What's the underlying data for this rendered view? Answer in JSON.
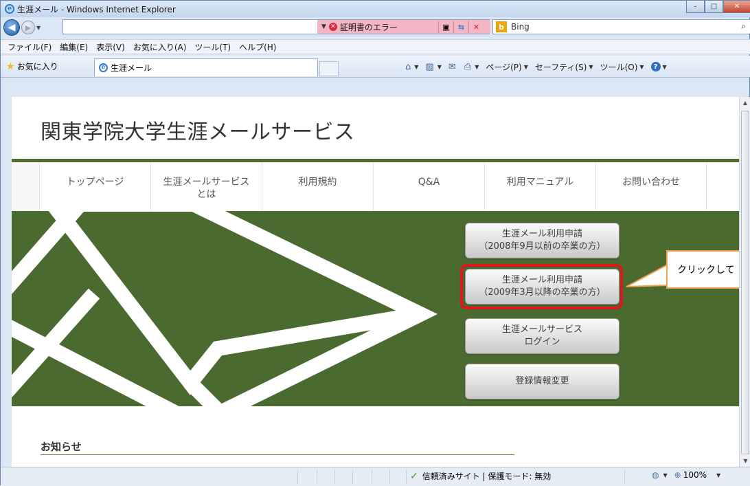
{
  "window": {
    "title": "生涯メール - Windows Internet Explorer",
    "minimize": "–",
    "maximize": "□",
    "close": "✕"
  },
  "address_bar": {
    "url": "",
    "cert_error": "証明書のエラー",
    "search_engine": "Bing",
    "search_icon": "⌕"
  },
  "menu": [
    "ファイル(F)",
    "編集(E)",
    "表示(V)",
    "お気に入り(A)",
    "ツール(T)",
    "ヘルプ(H)"
  ],
  "favorites": {
    "label": "お気に入り",
    "tab_title": "生涯メール"
  },
  "command_bar": {
    "page": "ページ(P)",
    "safety": "セーフティ(S)",
    "tools": "ツール(O)"
  },
  "site": {
    "title": "関東学院大学生涯メールサービス",
    "nav": [
      {
        "line1": "トップページ",
        "line2": ""
      },
      {
        "line1": "生涯メールサービス",
        "line2": "とは"
      },
      {
        "line1": "利用規約",
        "line2": ""
      },
      {
        "line1": "Q&A",
        "line2": ""
      },
      {
        "line1": "利用マニュアル",
        "line2": ""
      },
      {
        "line1": "お問い合わせ",
        "line2": ""
      }
    ],
    "buttons": [
      {
        "line1": "生涯メール利用申請",
        "line2": "（2008年9月以前の卒業の方）"
      },
      {
        "line1": "生涯メール利用申請",
        "line2": "（2009年3月以降の卒業の方）"
      },
      {
        "line1": "生涯メールサービス",
        "line2": "ログイン"
      },
      {
        "line1": "登録情報変更",
        "line2": ""
      }
    ],
    "callout": "クリックして",
    "news_title": "お知らせ"
  },
  "status_bar": {
    "zone": "信頼済みサイト | 保護モード: 無効",
    "zoom": "100%"
  },
  "colors": {
    "hero_green": "#4b6a30",
    "nav_border": "#4e6b30",
    "highlight_red": "#e0161e",
    "callout_orange": "#f2a24d",
    "cert_pink": "#f4b6c4"
  }
}
